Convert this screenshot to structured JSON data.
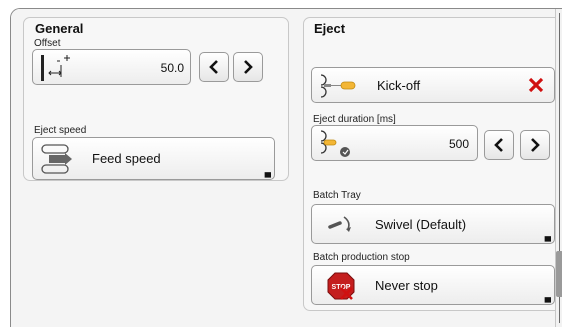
{
  "general": {
    "title": "General",
    "offset": {
      "label": "Offset",
      "value": "50.0",
      "icon": "offset-icon"
    },
    "eject_speed": {
      "label": "Eject speed",
      "value": "Feed speed",
      "icon": "feed-speed-icon"
    }
  },
  "eject": {
    "title": "Eject",
    "mode": {
      "value": "Kick-off",
      "icon": "kick-off-icon",
      "clear_icon": "close-icon",
      "clear_color": "#d01010"
    },
    "duration": {
      "label": "Eject duration [ms]",
      "value": "500",
      "icon": "eject-duration-icon"
    },
    "batch_tray": {
      "label": "Batch Tray",
      "value": "Swivel (Default)",
      "icon": "swivel-icon"
    },
    "batch_stop": {
      "label": "Batch production stop",
      "value": "Never stop",
      "icon": "stop-sign-icon",
      "stop_color": "#c41e1e"
    }
  }
}
